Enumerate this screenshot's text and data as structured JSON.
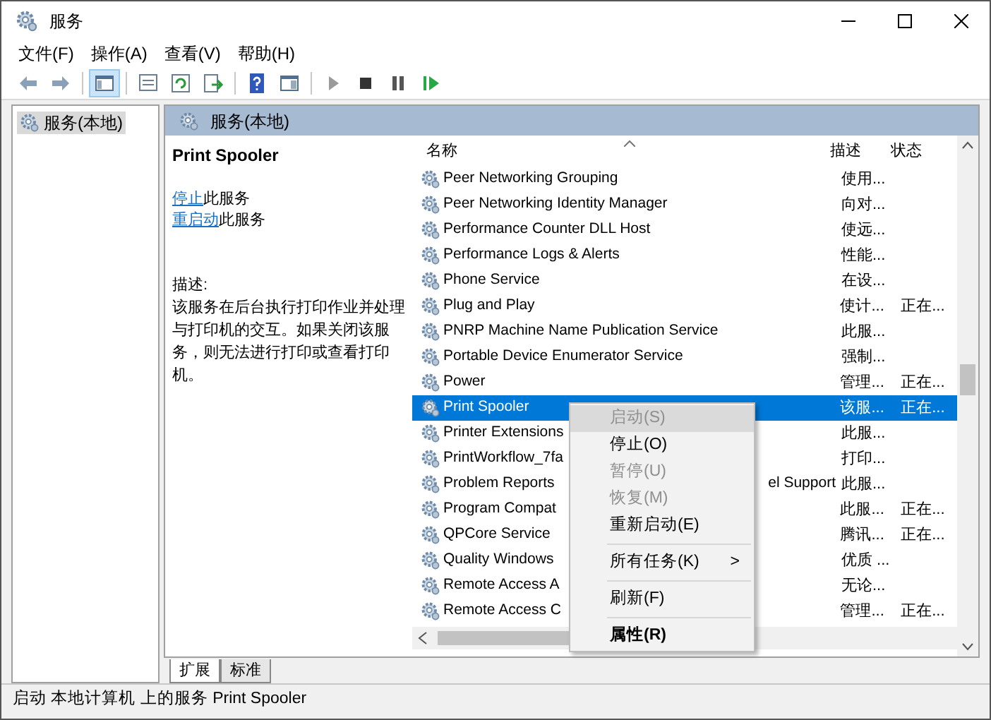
{
  "window": {
    "title": "服务"
  },
  "menu": [
    "文件(F)",
    "操作(A)",
    "查看(V)",
    "帮助(H)"
  ],
  "toolbar": [
    {
      "kind": "back"
    },
    {
      "kind": "forward"
    },
    {
      "kind": "sep"
    },
    {
      "kind": "tree",
      "selected": true
    },
    {
      "kind": "sep"
    },
    {
      "kind": "props"
    },
    {
      "kind": "refresh"
    },
    {
      "kind": "export"
    },
    {
      "kind": "sep"
    },
    {
      "kind": "help"
    },
    {
      "kind": "view"
    },
    {
      "kind": "sep"
    },
    {
      "kind": "play"
    },
    {
      "kind": "stop"
    },
    {
      "kind": "pause"
    },
    {
      "kind": "restart"
    }
  ],
  "tree": [
    {
      "label": "服务(本地)",
      "selected": true
    }
  ],
  "panel_title": "服务(本地)",
  "details": {
    "title": "Print Spooler",
    "actions": [
      {
        "link": "停止",
        "text": "此服务"
      },
      {
        "link": "重启动",
        "text": "此服务"
      }
    ],
    "desc_label": "描述:",
    "description": "该服务在后台执行打印作业并处理与打印机的交互。如果关闭该服务，则无法进行打印或查看打印机。"
  },
  "columns": [
    "名称",
    "描述",
    "状态"
  ],
  "rows": [
    {
      "name": "Peer Networking Grouping",
      "desc": "使用...",
      "status": "",
      "selected": false
    },
    {
      "name": "Peer Networking Identity Manager",
      "desc": "向对...",
      "status": "",
      "selected": false
    },
    {
      "name": "Performance Counter DLL Host",
      "desc": "使远...",
      "status": "",
      "selected": false
    },
    {
      "name": "Performance Logs & Alerts",
      "desc": "性能...",
      "status": "",
      "selected": false
    },
    {
      "name": "Phone Service",
      "desc": "在设...",
      "status": "",
      "selected": false
    },
    {
      "name": "Plug and Play",
      "desc": "使计...",
      "status": "正在...",
      "selected": false
    },
    {
      "name": "PNRP Machine Name Publication Service",
      "desc": "此服...",
      "status": "",
      "selected": false
    },
    {
      "name": "Portable Device Enumerator Service",
      "desc": "强制...",
      "status": "",
      "selected": false
    },
    {
      "name": "Power",
      "desc": "管理...",
      "status": "正在...",
      "selected": false
    },
    {
      "name": "Print Spooler",
      "desc": "该服...",
      "status": "正在...",
      "selected": true
    },
    {
      "name": "Printer Extensions",
      "desc": "此服...",
      "status": "",
      "selected": false
    },
    {
      "name": "PrintWorkflow_7fa",
      "desc": "打印...",
      "status": "",
      "selected": false
    },
    {
      "name": "Problem Reports",
      "name_tail": "el Support",
      "desc": "此服...",
      "status": "",
      "selected": false
    },
    {
      "name": "Program Compat",
      "desc": "此服...",
      "status": "正在...",
      "selected": false
    },
    {
      "name": "QPCore Service",
      "desc": "腾讯...",
      "status": "正在...",
      "selected": false
    },
    {
      "name": "Quality Windows",
      "desc": "优质 ...",
      "status": "",
      "selected": false
    },
    {
      "name": "Remote Access A",
      "desc": "无论...",
      "status": "",
      "selected": false
    },
    {
      "name": "Remote Access C",
      "desc": "管理...",
      "status": "正在...",
      "selected": false
    }
  ],
  "context_menu": [
    {
      "kind": "item",
      "label": "启动(S)",
      "disabled": true,
      "selected": true
    },
    {
      "kind": "item",
      "label": "停止(O)",
      "disabled": false,
      "selected": false
    },
    {
      "kind": "item",
      "label": "暂停(U)",
      "disabled": true,
      "selected": false
    },
    {
      "kind": "item",
      "label": "恢复(M)",
      "disabled": true,
      "selected": false
    },
    {
      "kind": "item",
      "label": "重新启动(E)",
      "disabled": false,
      "selected": false
    },
    {
      "kind": "sep"
    },
    {
      "kind": "submenu",
      "label": "所有任务(K)",
      "arrow": ">",
      "disabled": false,
      "selected": false
    },
    {
      "kind": "sep"
    },
    {
      "kind": "item",
      "label": "刷新(F)",
      "disabled": false,
      "selected": false
    },
    {
      "kind": "sep"
    },
    {
      "kind": "default",
      "label": "属性(R)",
      "disabled": false,
      "selected": false
    }
  ],
  "tabs": [
    {
      "label": "扩展",
      "selected": true
    },
    {
      "label": "标准",
      "selected": false
    }
  ],
  "status_bar": "启动 本地计算机 上的服务 Print Spooler"
}
